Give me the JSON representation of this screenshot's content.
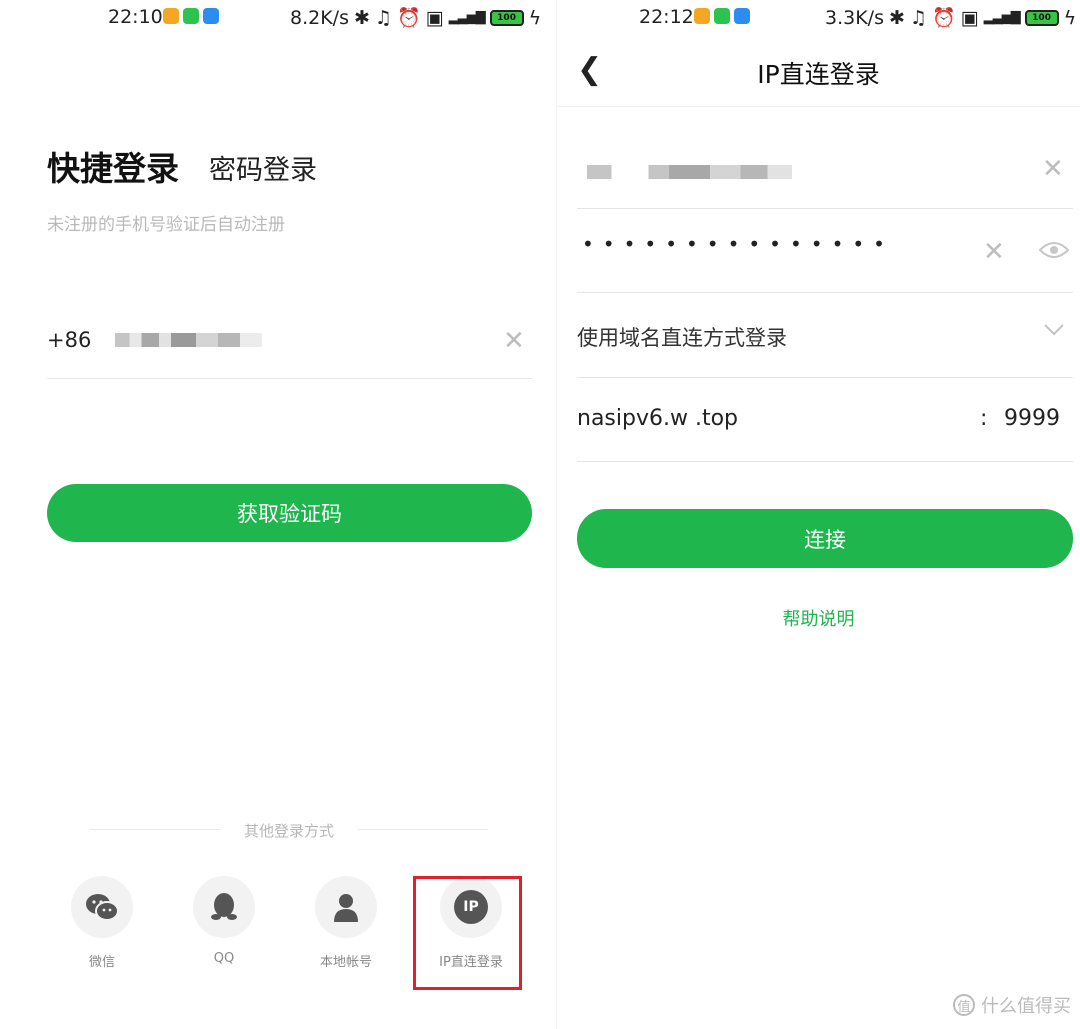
{
  "left": {
    "status": {
      "time": "22:10",
      "speed": "8.2K/s",
      "battery": "100"
    },
    "tabs": {
      "quick": "快捷登录",
      "password": "密码登录"
    },
    "hint": "未注册的手机号验证后自动注册",
    "phone": {
      "prefix": "+86",
      "clear_icon": "close-icon"
    },
    "button_label": "获取验证码",
    "other_login": {
      "label": "其他登录方式",
      "options": [
        {
          "label": "微信",
          "icon": "wechat-icon"
        },
        {
          "label": "QQ",
          "icon": "qq-icon"
        },
        {
          "label": "本地帐号",
          "icon": "user-icon"
        },
        {
          "label": "IP直连登录",
          "icon": "ip-icon",
          "icon_text": "IP"
        }
      ]
    },
    "highlight_color": "#e0202a"
  },
  "right": {
    "status": {
      "time": "22:12",
      "speed": "3.3K/s",
      "battery": "100"
    },
    "title": "IP直连登录",
    "password_mask": "•••••••••••••••",
    "mode_label": "使用域名直连方式登录",
    "host_value": "nasipv6.w    .top",
    "port_separator": ":",
    "port_value": "9999",
    "button_label": "连接",
    "help_link": "帮助说明"
  },
  "colors": {
    "accent": "#1fb64e",
    "highlight": "#e0202a"
  },
  "watermark": "什么值得买",
  "watermark_logo": "值"
}
